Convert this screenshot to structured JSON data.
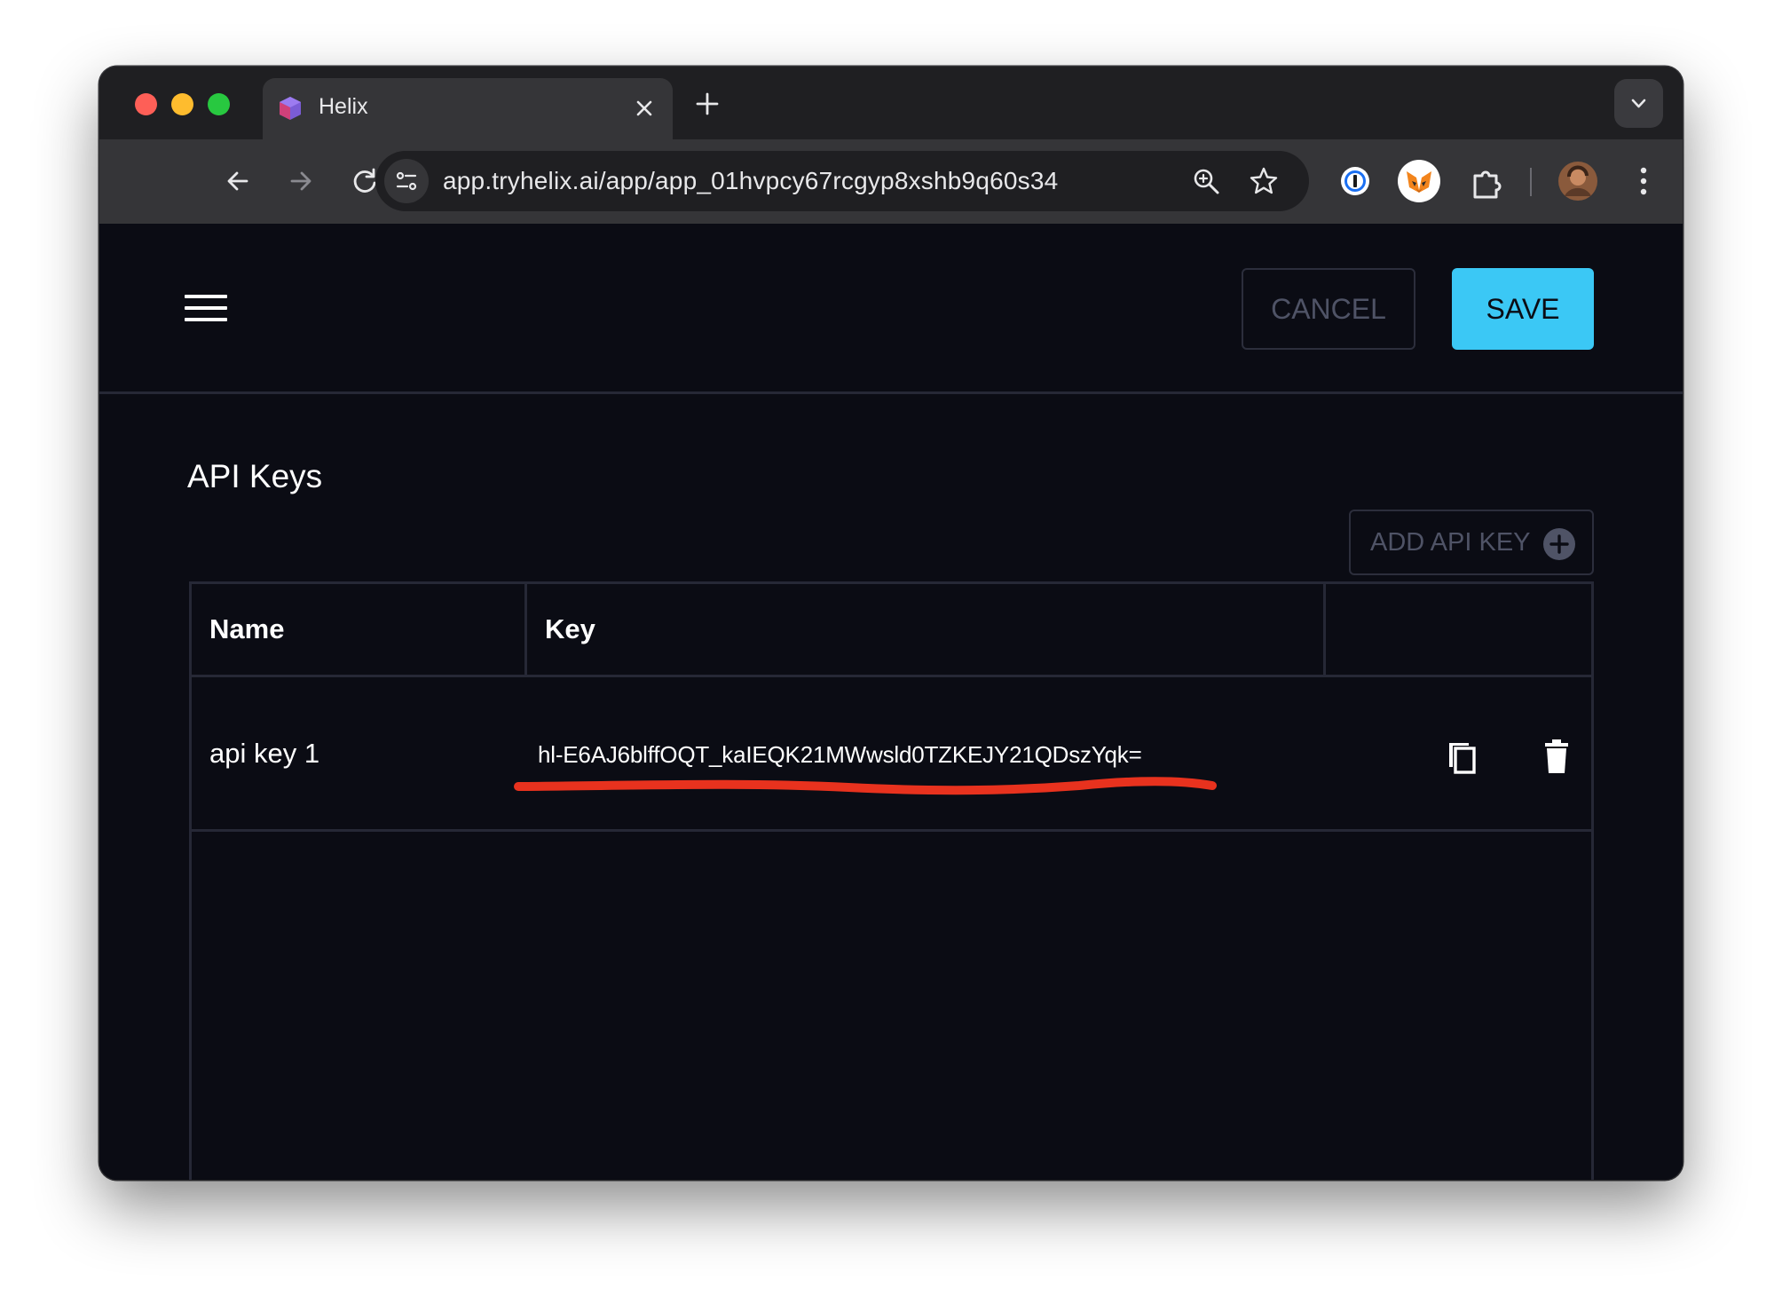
{
  "browser": {
    "tab_title": "Helix",
    "url": "app.tryhelix.ai/app/app_01hvpcy67rcgyp8xshb9q60s34"
  },
  "toolbar": {
    "cancel_label": "CANCEL",
    "save_label": "SAVE"
  },
  "api_keys": {
    "title": "API Keys",
    "add_label": "ADD API KEY",
    "columns": [
      "Name",
      "Key",
      ""
    ],
    "rows": [
      {
        "name": "api key 1",
        "key": "hl-E6AJ6blffOQT_kaIEQK21MWwsld0TZKEJY21QDszYqk="
      }
    ]
  },
  "colors": {
    "save_accent": "#3bc8f5",
    "background": "#0b0c14",
    "annotation": "#e8321e"
  },
  "icons": [
    "back-arrow-icon",
    "forward-arrow-icon",
    "reload-icon",
    "home-icon",
    "site-settings-icon",
    "zoom-icon",
    "star-icon",
    "onepassword-icon",
    "metamask-icon",
    "extensions-icon",
    "profile-avatar",
    "kebab-menu-icon",
    "hamburger-menu-icon",
    "add-circle-icon",
    "copy-icon",
    "trash-icon"
  ]
}
